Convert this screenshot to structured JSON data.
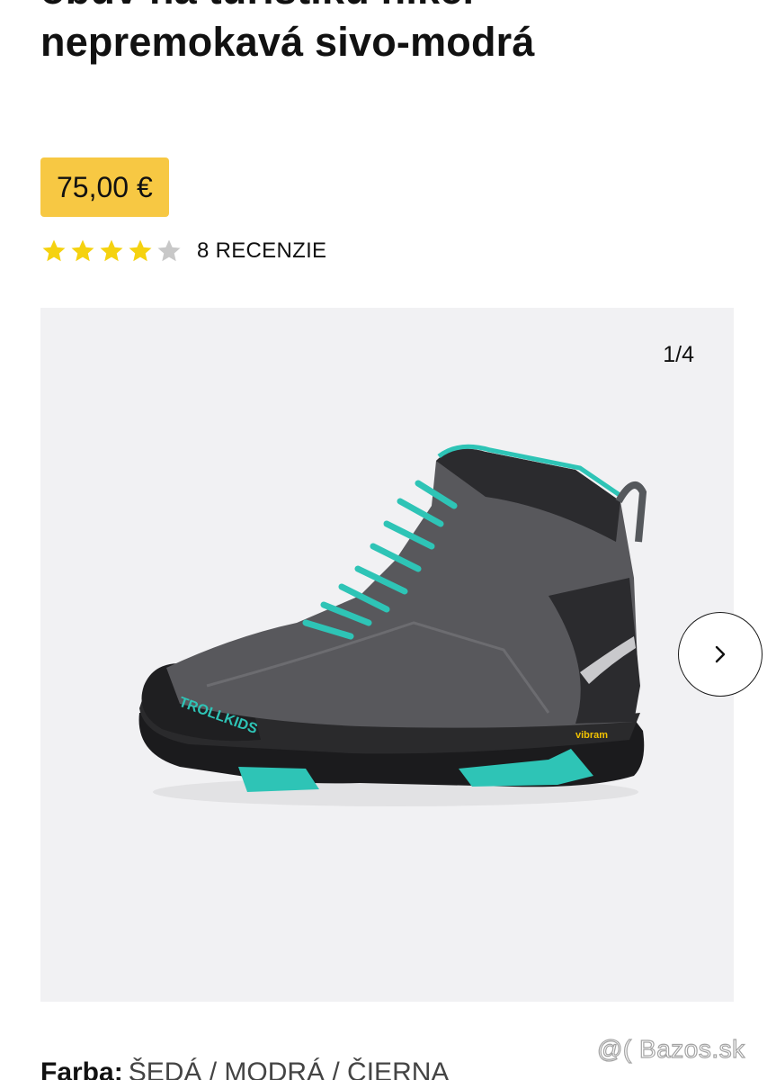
{
  "product": {
    "title_lines": [
      "obuv na turistiku hiker",
      "nepremokavá sivo-modrá"
    ],
    "price": "75,00 €",
    "rating": {
      "value": 4,
      "max": 5
    },
    "reviews_label": "8 RECENZIE"
  },
  "gallery": {
    "counter": "1/4",
    "image_alt": "Trollkids hiking boot grey-turquoise",
    "next_icon": "chevron-right-icon"
  },
  "attributes": {
    "color_label": "Farba:",
    "color_value": "ŠEDÁ / MODRÁ / ČIERNA"
  },
  "watermark": "@( Bazos.sk",
  "colors": {
    "price_badge": "#f7c843",
    "star_filled": "#f5d210",
    "star_empty": "#c8c8c8",
    "gallery_bg": "#f1f1f3"
  }
}
